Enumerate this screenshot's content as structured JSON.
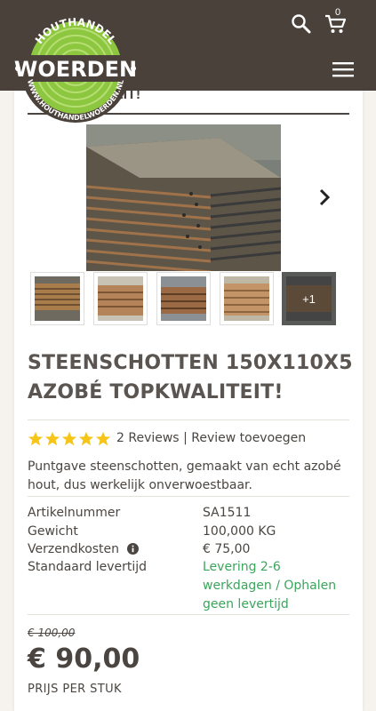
{
  "header": {
    "logo": {
      "top_text": "HOUTHANDEL",
      "main_text": "WOERDEN",
      "bottom_text": "WWW.HOUTHANDELWOERDEN.NL"
    },
    "cart_count": "0",
    "icons": [
      "search-icon",
      "cart-icon",
      "hamburger-menu-icon"
    ],
    "bg_color": "#4a413a"
  },
  "partial_title": "EIT!",
  "gallery": {
    "thumbnails_count": 4,
    "more_label": "+1",
    "next_icon": "chevron-right-icon"
  },
  "product": {
    "title": "STEENSCHOTTEN 150X110X5 AZOBÉ TOPKWALITEIT!",
    "rating": 5,
    "reviews_label": "2 Reviews",
    "separator": "|",
    "review_add_label": "Review toevoegen",
    "description": "Puntgave steenschotten, gemaakt van echt azobé hout, dus werkelijk onverwoestbaar.",
    "specs": [
      {
        "label": "Artikelnummer",
        "value": "SA1511"
      },
      {
        "label": "Gewicht",
        "value": "100,000 KG"
      },
      {
        "label": "Verzendkosten",
        "value": "€ 75,00"
      },
      {
        "label": "Standaard levertijd",
        "value": "Levering 2-6 werkdagen / Ophalen geen levertijd"
      }
    ],
    "old_price": "€ 100,00",
    "price": "€ 90,00",
    "price_unit": "PRIJS PER STUK",
    "link_color": "#3ba55c",
    "star_color": "#f5c518"
  }
}
